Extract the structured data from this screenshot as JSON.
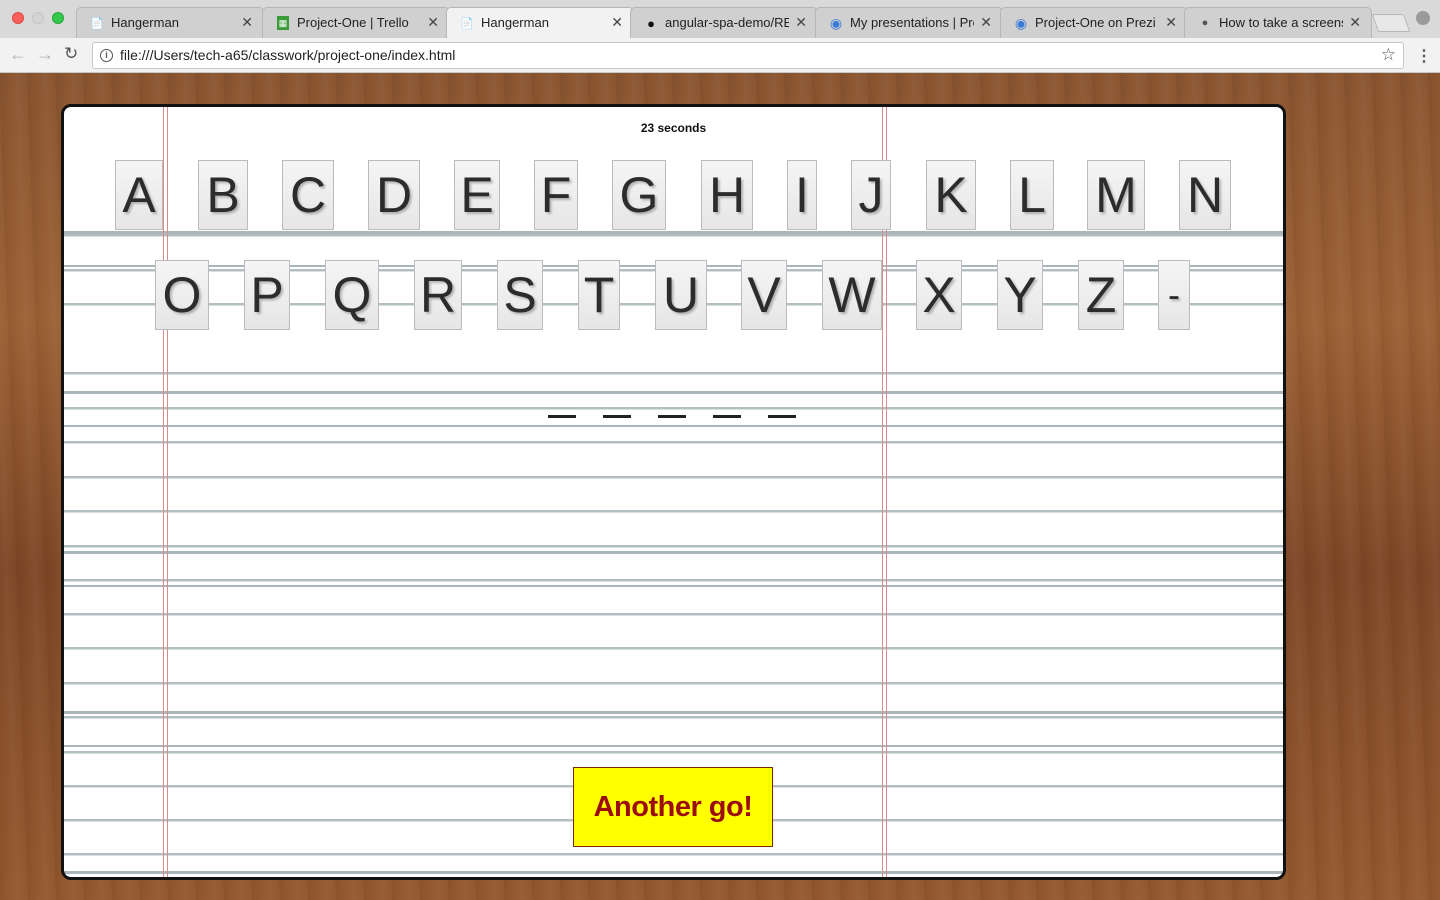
{
  "browser": {
    "tabs": [
      {
        "title": "Hangerman",
        "icon": "page-icon",
        "active": false
      },
      {
        "title": "Project-One | Trello",
        "icon": "trello-icon",
        "active": false
      },
      {
        "title": "Hangerman",
        "icon": "page-icon",
        "active": true
      },
      {
        "title": "angular-spa-demo/REA",
        "icon": "github-icon",
        "active": false
      },
      {
        "title": "My presentations | Pre",
        "icon": "prezi-icon",
        "active": false
      },
      {
        "title": "Project-One on Prezi N",
        "icon": "prezi-icon",
        "active": false
      },
      {
        "title": "How to take a screensh",
        "icon": "apple-icon",
        "active": false
      }
    ],
    "url": "file:///Users/tech-a65/classwork/project-one/index.html"
  },
  "game": {
    "timer": "23 seconds",
    "letters_row1": [
      "A",
      "B",
      "C",
      "D",
      "E",
      "F",
      "G",
      "H",
      "I",
      "J",
      "K",
      "L",
      "M",
      "N"
    ],
    "letters_row2": [
      "O",
      "P",
      "Q",
      "R",
      "S",
      "T",
      "U",
      "V",
      "W",
      "X",
      "Y",
      "Z",
      "-"
    ],
    "word_blanks": 5,
    "again_label": "Another go!"
  },
  "colors": {
    "button_bg": "#ffff00",
    "button_text": "#9b0d0d",
    "margin_line": "#d98c8c"
  }
}
